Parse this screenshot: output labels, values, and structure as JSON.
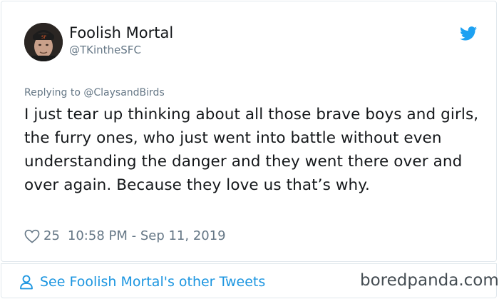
{
  "author": {
    "display_name": "Foolish Mortal",
    "handle": "@TKintheSFC"
  },
  "reply": {
    "prefix": "Replying to",
    "mention": "@ClaysandBirds"
  },
  "tweet": {
    "text": "I just tear up thinking about all those brave boys and girls, the furry ones, who just went into battle without even understanding the danger and they went there over and over again. Because they love us that’s why.",
    "like_count": "25",
    "timestamp": "10:58 PM - Sep 11, 2019"
  },
  "footer": {
    "link_label": "See Foolish Mortal's other Tweets"
  },
  "watermark": {
    "text": "boredpanda.com"
  },
  "icons": {
    "brand": "twitter-bird-icon",
    "like": "heart-icon",
    "profile": "person-icon"
  },
  "colors": {
    "twitter_blue": "#1da1f2",
    "link_blue": "#1b95e0",
    "muted_gray": "#657786",
    "text_dark": "#14171a"
  }
}
